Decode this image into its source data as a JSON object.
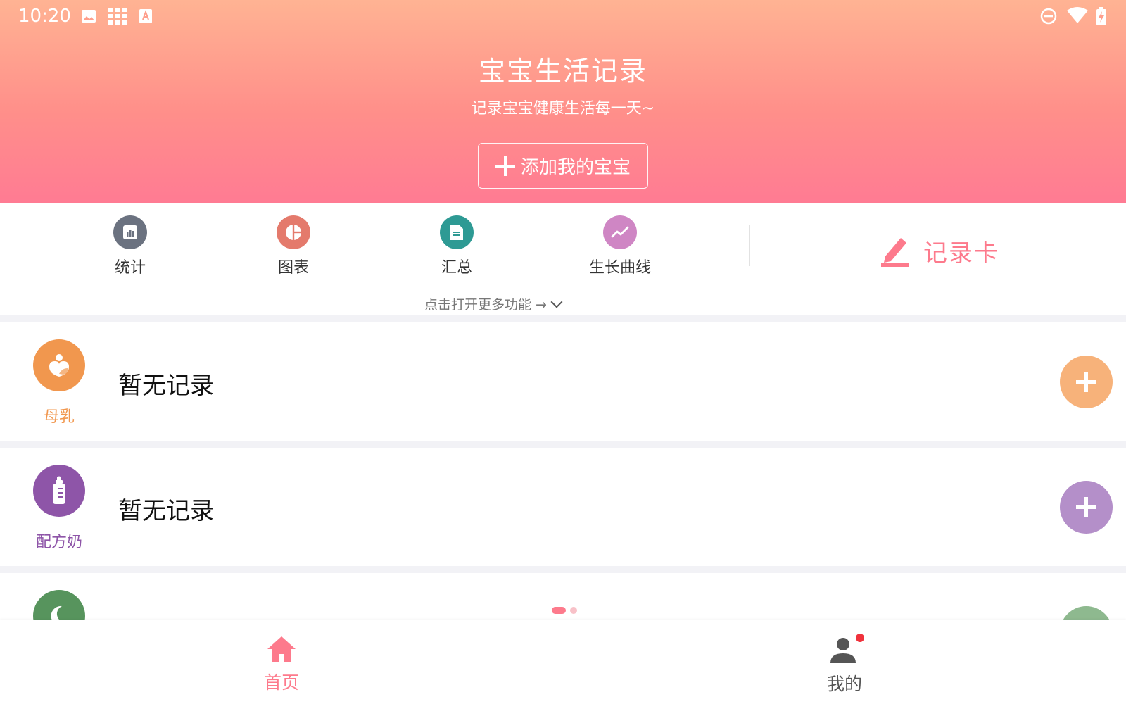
{
  "status_bar": {
    "time": "10:20",
    "left_icons": [
      "image-icon",
      "grid-icon",
      "keyboard-a-icon"
    ],
    "right_icons": [
      "do-not-disturb-icon",
      "wifi-icon",
      "battery-charging-icon"
    ]
  },
  "header": {
    "title": "宝宝生活记录",
    "subtitle": "记录宝宝健康生活每一天~",
    "add_button_label": "添加我的宝宝",
    "gradient_colors": [
      "#ffb393",
      "#ff8f8a",
      "#ff7b93"
    ]
  },
  "functions": {
    "items": [
      {
        "label": "统计",
        "icon": "bar-chart-icon",
        "color": "#6b7280"
      },
      {
        "label": "图表",
        "icon": "pie-chart-icon",
        "color": "#e47a6c"
      },
      {
        "label": "汇总",
        "icon": "document-icon",
        "color": "#2e9a94"
      },
      {
        "label": "生长曲线",
        "icon": "trend-line-icon",
        "color": "#cf86c4"
      }
    ],
    "record_card_label": "记录卡",
    "record_card_color": "#fd7a8c",
    "more_hint": "点击打开更多功能 →"
  },
  "records": [
    {
      "category": "母乳",
      "icon": "breast-milk-icon",
      "color": "#f1974e",
      "add_color": "#f7b27a",
      "status": "暂无记录"
    },
    {
      "category": "配方奶",
      "icon": "baby-bottle-icon",
      "color": "#8e55a8",
      "add_color": "#b48fc9",
      "status": "暂无记录"
    },
    {
      "category": "",
      "icon": "moon-icon",
      "color": "#57945d",
      "add_color": "#8eb98f",
      "status": ""
    }
  ],
  "pager": {
    "active_color": "#fd7a8c",
    "inactive_color": "#f8c1c8"
  },
  "bottom_nav": {
    "items": [
      {
        "label": "首页",
        "icon": "home-icon",
        "active": true,
        "color": "#fd7a8c"
      },
      {
        "label": "我的",
        "icon": "person-icon",
        "active": false,
        "color": "#555555",
        "has_badge": true
      }
    ]
  }
}
